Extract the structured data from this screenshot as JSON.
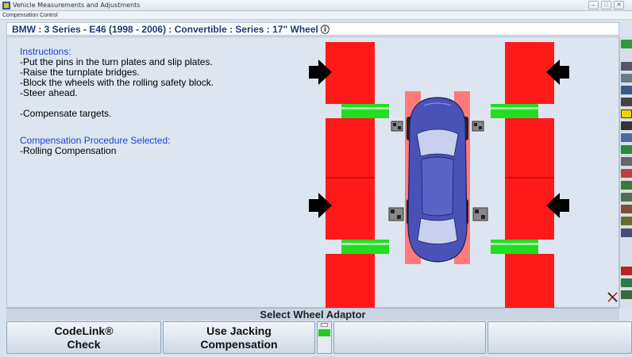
{
  "window": {
    "title": "Vehicle Measurements and Adjustments",
    "subtitle": "Compensation Control",
    "controls": [
      "–",
      "□",
      "✕"
    ]
  },
  "vehicle": {
    "title": "BMW : 3 Series - E46 (1998 - 2006) : Convertible : Series : 17\" Wheel",
    "info_icon": "ⓘ"
  },
  "instructions": {
    "heading": "Instructions:",
    "steps": [
      "-Put the pins in the turn plates and slip plates.",
      "-Raise the turnplate bridges.",
      "-Block the wheels with the rolling safety block.",
      "-Steer ahead."
    ],
    "extra": "-Compensate targets.",
    "procedure_heading": "Compensation Procedure Selected:",
    "procedure_value": "-Rolling Compensation"
  },
  "status": {
    "text": "Select Wheel Adaptor"
  },
  "fkeys": [
    {
      "line1": "CodeLink®",
      "line2": "Check"
    },
    {
      "line1": "Use Jacking",
      "line2": "Compensation"
    },
    {
      "line1": "",
      "line2": ""
    },
    {
      "line1": "",
      "line2": ""
    }
  ],
  "colors": {
    "rack_red": "#ff1a1a",
    "rack_pink": "#ff7a7a",
    "plate_green": "#22dd22",
    "car_blue": "#4a52b8",
    "arrow": "#000000"
  }
}
